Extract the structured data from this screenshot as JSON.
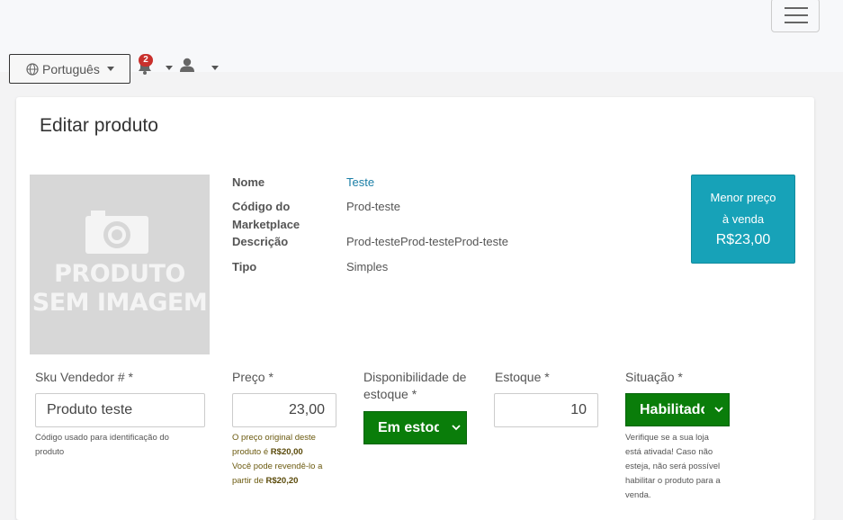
{
  "header": {
    "language_label": "Português",
    "notification_count": "2",
    "icons": {
      "menu": "hamburger-icon",
      "language": "globe-icon",
      "notifications": "bell-icon",
      "user": "user-icon"
    }
  },
  "page": {
    "title": "Editar produto"
  },
  "image_placeholder": {
    "line1": "PRODUTO",
    "line2": "SEM IMAGEM",
    "icon": "camera-icon"
  },
  "details": {
    "name_label": "Nome",
    "name_value": "Teste",
    "code_label_1": "Código do",
    "code_label_2": "Marketplace",
    "code_value": "Prod-teste",
    "desc_label": "Descrição",
    "desc_value": "Prod-testeProd-testeProd-teste",
    "type_label": "Tipo",
    "type_value": "Simples"
  },
  "lowest_price": {
    "line1": "Menor preço",
    "line2": "à venda",
    "value": "R$23,00",
    "color": "#17a2b8"
  },
  "form": {
    "sku": {
      "label": "Sku Vendedor # *",
      "value": "Produto teste",
      "help_1": "Código usado para identificação do",
      "help_2": "produto"
    },
    "price": {
      "label": "Preço *",
      "value": "23,00",
      "help_1": "O preço original deste",
      "help_2_prefix": "produto é ",
      "help_2_value": "R$20,00",
      "help_3": "Você pode revendê-lo a",
      "help_4_prefix": "partir de ",
      "help_4_value": "R$20,20"
    },
    "availability": {
      "label_1": "Disponibilidade de",
      "label_2": "estoque *",
      "value": "Em estoque",
      "color": "#0a7d0a"
    },
    "stock": {
      "label": "Estoque *",
      "value": "10"
    },
    "status": {
      "label": "Situação *",
      "value": "Habilitado",
      "color": "#0a7d0a",
      "help_1": "Verifique se a sua loja",
      "help_2": "está ativada! Caso não",
      "help_3": "esteja, não será possível",
      "help_4": "habilitar o produto para a",
      "help_5": "venda."
    }
  }
}
